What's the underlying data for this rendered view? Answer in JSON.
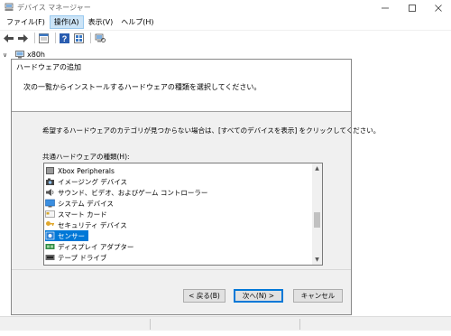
{
  "window": {
    "title": "デバイス マネージャー",
    "icon": "device-manager-icon"
  },
  "menu": {
    "items": [
      {
        "label": "ファイル(F)"
      },
      {
        "label": "操作(A)"
      },
      {
        "label": "表示(V)"
      },
      {
        "label": "ヘルプ(H)"
      }
    ]
  },
  "toolbar": {
    "icons": [
      "back-arrow-icon",
      "forward-arrow-icon",
      "properties-icon",
      "help-icon",
      "view-icon",
      "scan-hardware-icon"
    ]
  },
  "tree": {
    "root_label": "x80h"
  },
  "dialog": {
    "title": "ハードウェアの追加",
    "heading": "次の一覧からインストールするハードウェアの種類を選択してください。",
    "instruction": "希望するハードウェアのカテゴリが見つからない場合は、[すべてのデバイスを表示] をクリックしてください。",
    "list_label": "共通ハードウェアの種類(H):",
    "list_items": [
      {
        "label": "Xbox Peripherals",
        "icon": "xbox-icon"
      },
      {
        "label": "イメージング デバイス",
        "icon": "camera-icon"
      },
      {
        "label": "サウンド、ビデオ、およびゲーム コントローラー",
        "icon": "speaker-icon"
      },
      {
        "label": "システム デバイス",
        "icon": "system-device-icon"
      },
      {
        "label": "スマート カード",
        "icon": "smart-card-icon"
      },
      {
        "label": "セキュリティ デバイス",
        "icon": "security-key-icon"
      },
      {
        "label": "センサー",
        "icon": "sensor-icon"
      },
      {
        "label": "ディスプレイ アダプター",
        "icon": "display-adapter-icon"
      },
      {
        "label": "テープ ドライブ",
        "icon": "tape-drive-icon"
      }
    ],
    "selected_item": "センサー",
    "buttons": {
      "back": "< 戻る(B)",
      "next": "次へ(N) >",
      "cancel": "キャンセル"
    }
  },
  "colors": {
    "selection": "#0078d7",
    "menu_active": "#cce4f7",
    "dialog_bg": "#f0f0f0"
  }
}
